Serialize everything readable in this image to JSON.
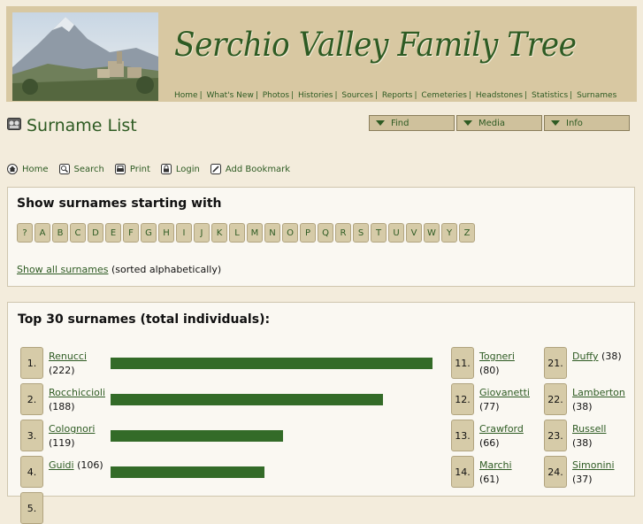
{
  "header": {
    "title": "Serchio Valley Family Tree",
    "nav": [
      "Home",
      "What's New",
      "Photos",
      "Histories",
      "Sources",
      "Reports",
      "Cemeteries",
      "Headstones",
      "Statistics",
      "Surnames"
    ]
  },
  "page": {
    "title": "Surname List"
  },
  "menus": [
    "Find",
    "Media",
    "Info"
  ],
  "toolbar": [
    "Home",
    "Search",
    "Print",
    "Login",
    "Add Bookmark"
  ],
  "letters_panel": {
    "heading": "Show surnames starting with",
    "letters": [
      "?",
      "A",
      "B",
      "C",
      "D",
      "E",
      "F",
      "G",
      "H",
      "I",
      "J",
      "K",
      "L",
      "M",
      "N",
      "O",
      "P",
      "Q",
      "R",
      "S",
      "T",
      "U",
      "V",
      "W",
      "Y",
      "Z"
    ],
    "show_all_link": "Show all surnames",
    "show_all_note": "(sorted alphabetically)"
  },
  "top_panel": {
    "heading": "Top 30 surnames (total individuals):",
    "col1": [
      {
        "rank": "1.",
        "name": "Renucci",
        "count": "(222)",
        "value": 222
      },
      {
        "rank": "2.",
        "name": "Rocchiccioli",
        "count": "(188)",
        "value": 188
      },
      {
        "rank": "3.",
        "name": "Colognori",
        "count": "(119)",
        "value": 119
      },
      {
        "rank": "4.",
        "name": "Guidi",
        "count": "(106)",
        "value": 106
      },
      {
        "rank": "5.",
        "name": "",
        "count": "",
        "value": 0
      }
    ],
    "col2": [
      {
        "rank": "11.",
        "name": "Togneri",
        "count": "(80)"
      },
      {
        "rank": "12.",
        "name": "Giovanetti",
        "count": "(77)"
      },
      {
        "rank": "13.",
        "name": "Crawford",
        "count": "(66)"
      },
      {
        "rank": "14.",
        "name": "Marchi",
        "count": "(61)"
      }
    ],
    "col3": [
      {
        "rank": "21.",
        "name": "Duffy",
        "count": "(38)"
      },
      {
        "rank": "22.",
        "name": "Lamberton",
        "count": "(38)"
      },
      {
        "rank": "23.",
        "name": "Russell",
        "count": "(38)"
      },
      {
        "rank": "24.",
        "name": "Simonini",
        "count": "(37)"
      }
    ]
  },
  "colors": {
    "accent": "#2e5b23",
    "bar": "#336b28",
    "header_bg": "#d8c8a2",
    "page_bg": "#f3ecdc"
  }
}
